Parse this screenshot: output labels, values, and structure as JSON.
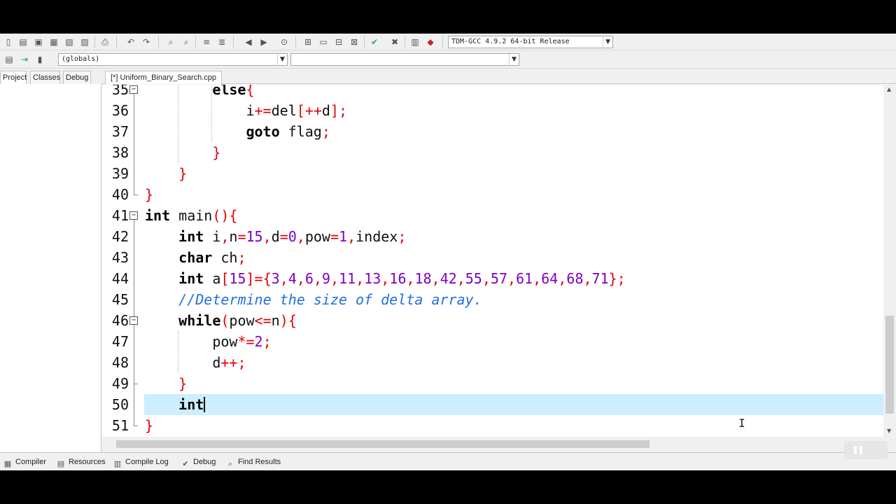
{
  "toolbar": {
    "icons": [
      "new-icon",
      "open-icon",
      "save-icon",
      "save-all-icon",
      "close-icon",
      "close-all-icon",
      "print-icon",
      "undo-icon",
      "redo-icon",
      "find-icon",
      "replace-icon",
      "indent-icon",
      "unindent-icon",
      "bookmark-prev-icon",
      "bookmark-next-icon",
      "goto-icon",
      "new-project-icon",
      "project-options-icon",
      "add-file-icon",
      "remove-file-icon",
      "check-icon",
      "stop-icon",
      "chart-icon",
      "profile-icon"
    ],
    "compiler_select": "TDM-GCC 4.9.2 64-bit Release",
    "scope_select": "(globals)",
    "symbol_select": ""
  },
  "left_panel": {
    "tabs": [
      "Project",
      "Classes",
      "Debug"
    ]
  },
  "editor": {
    "tab_label": "[*] Uniform_Binary_Search.cpp",
    "lines": [
      {
        "no": "35",
        "tokens": [
          [
            "kw",
            "else"
          ],
          [
            "sym",
            "{"
          ]
        ]
      },
      {
        "no": "36",
        "tokens": [
          [
            "t",
            "i"
          ],
          [
            "sym",
            "+="
          ],
          [
            "t",
            "del"
          ],
          [
            "sym",
            "[++"
          ],
          [
            "t",
            "d"
          ],
          [
            "sym",
            "];"
          ]
        ]
      },
      {
        "no": "37",
        "tokens": [
          [
            "kw",
            "goto"
          ],
          [
            "t",
            " flag"
          ],
          [
            "sym",
            ";"
          ]
        ]
      },
      {
        "no": "38",
        "tokens": [
          [
            "sym",
            "}"
          ]
        ]
      },
      {
        "no": "39",
        "tokens": [
          [
            "sym",
            "}"
          ]
        ]
      },
      {
        "no": "40",
        "tokens": [
          [
            "sym",
            "}"
          ]
        ]
      },
      {
        "no": "41",
        "tokens": [
          [
            "kw",
            "int"
          ],
          [
            "t",
            " main"
          ],
          [
            "sym",
            "(){"
          ]
        ]
      },
      {
        "no": "42",
        "tokens": [
          [
            "kw",
            "int"
          ],
          [
            "t",
            " i"
          ],
          [
            "sym",
            ","
          ],
          [
            "t",
            "n"
          ],
          [
            "sym",
            "="
          ],
          [
            "num",
            "15"
          ],
          [
            "sym",
            ","
          ],
          [
            "t",
            "d"
          ],
          [
            "sym",
            "="
          ],
          [
            "num",
            "0"
          ],
          [
            "sym",
            ","
          ],
          [
            "t",
            "pow"
          ],
          [
            "sym",
            "="
          ],
          [
            "num",
            "1"
          ],
          [
            "sym",
            ","
          ],
          [
            "t",
            "index"
          ],
          [
            "sym",
            ";"
          ]
        ]
      },
      {
        "no": "43",
        "tokens": [
          [
            "kw",
            "char"
          ],
          [
            "t",
            " ch"
          ],
          [
            "sym",
            ";"
          ]
        ]
      },
      {
        "no": "44",
        "tokens": [
          [
            "kw",
            "int"
          ],
          [
            "t",
            " a"
          ],
          [
            "sym",
            "["
          ],
          [
            "num",
            "15"
          ],
          [
            "sym",
            "]={"
          ],
          [
            "num",
            "3"
          ],
          [
            "sym",
            ","
          ],
          [
            "num",
            "4"
          ],
          [
            "sym",
            ","
          ],
          [
            "num",
            "6"
          ],
          [
            "sym",
            ","
          ],
          [
            "num",
            "9"
          ],
          [
            "sym",
            ","
          ],
          [
            "num",
            "11"
          ],
          [
            "sym",
            ","
          ],
          [
            "num",
            "13"
          ],
          [
            "sym",
            ","
          ],
          [
            "num",
            "16"
          ],
          [
            "sym",
            ","
          ],
          [
            "num",
            "18"
          ],
          [
            "sym",
            ","
          ],
          [
            "num",
            "42"
          ],
          [
            "sym",
            ","
          ],
          [
            "num",
            "55"
          ],
          [
            "sym",
            ","
          ],
          [
            "num",
            "57"
          ],
          [
            "sym",
            ","
          ],
          [
            "num",
            "61"
          ],
          [
            "sym",
            ","
          ],
          [
            "num",
            "64"
          ],
          [
            "sym",
            ","
          ],
          [
            "num",
            "68"
          ],
          [
            "sym",
            ","
          ],
          [
            "num",
            "71"
          ],
          [
            "sym",
            "};"
          ]
        ]
      },
      {
        "no": "45",
        "tokens": [
          [
            "cmt",
            "//Determine the size of delta array."
          ]
        ]
      },
      {
        "no": "46",
        "tokens": [
          [
            "kw",
            "while"
          ],
          [
            "sym",
            "("
          ],
          [
            "t",
            "pow"
          ],
          [
            "sym",
            "<="
          ],
          [
            "t",
            "n"
          ],
          [
            "sym",
            "){"
          ]
        ]
      },
      {
        "no": "47",
        "tokens": [
          [
            "t",
            "pow"
          ],
          [
            "sym",
            "*="
          ],
          [
            "num",
            "2"
          ],
          [
            "sym",
            ";"
          ]
        ]
      },
      {
        "no": "48",
        "tokens": [
          [
            "t",
            "d"
          ],
          [
            "sym",
            "++;"
          ]
        ]
      },
      {
        "no": "49",
        "tokens": [
          [
            "sym",
            "}"
          ]
        ]
      },
      {
        "no": "50",
        "tokens": [
          [
            "kw",
            "int"
          ]
        ]
      },
      {
        "no": "51",
        "tokens": [
          [
            "sym",
            "}"
          ]
        ]
      }
    ]
  },
  "bottom_tabs": [
    {
      "label": "Compiler",
      "icon": "compiler-icon"
    },
    {
      "label": "Resources",
      "icon": "resources-icon"
    },
    {
      "label": "Compile Log",
      "icon": "compile-log-icon"
    },
    {
      "label": "Debug",
      "icon": "debug-icon"
    },
    {
      "label": "Find Results",
      "icon": "find-results-icon"
    }
  ],
  "colors": {
    "keyword": "#000000",
    "symbol": "#e0000c",
    "number": "#8000c0",
    "comment": "#2070e0",
    "current_line": "#cceeff"
  }
}
